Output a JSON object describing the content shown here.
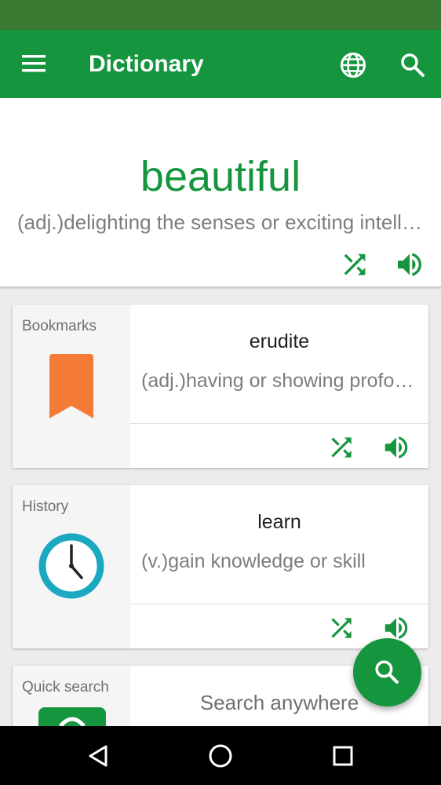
{
  "app_bar": {
    "title": "Dictionary",
    "icons": [
      "menu-icon",
      "globe-icon",
      "search-icon"
    ]
  },
  "word_of_the_day": {
    "word": "beautiful",
    "definition": "(adj.)delighting the senses or exciting intellectual or emotional admiration"
  },
  "cards": {
    "bookmarks": {
      "label": "Bookmarks",
      "word": "erudite",
      "definition": "(adj.)having or showing profound knowledge"
    },
    "history": {
      "label": "History",
      "word": "learn",
      "definition": "(v.)gain knowledge or skill"
    },
    "quick_search": {
      "label": "Quick search",
      "text": "Search anywhere"
    }
  },
  "colors": {
    "primary": "#16953f",
    "status_bar": "#3a7a33",
    "bookmark": "#f47b35",
    "clock": "#1aa9c0"
  }
}
